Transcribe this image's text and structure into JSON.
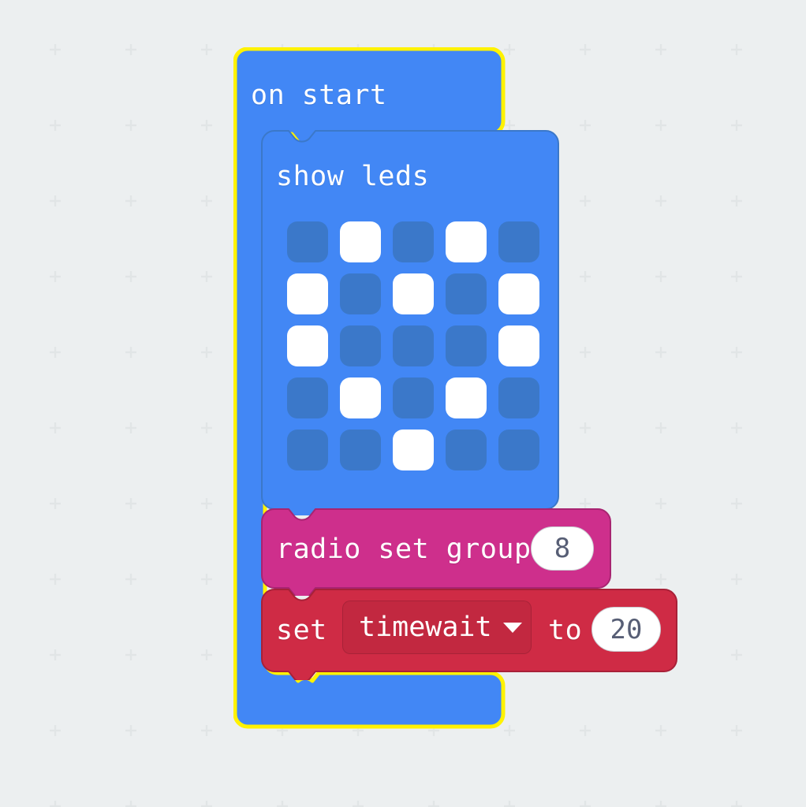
{
  "workspace": {
    "background_color": "#eceff0",
    "grid_cross_color": "#e2e5e6",
    "grid_spacing": 96
  },
  "palette": {
    "event_blue": "#4287f5",
    "event_blue_stroke": "#3b78c9",
    "led_off": "#3b78c9",
    "led_on": "#ffffff",
    "radio_pink": "#ce2f8c",
    "radio_pink_stroke": "#a82471",
    "variable_red": "#cf2b45",
    "variable_red_stroke": "#a82138",
    "selection_yellow": "#fff200",
    "field_text": "#575e75"
  },
  "blocks": {
    "on_start": {
      "label": "on start",
      "type": "event-hat",
      "selected": true
    },
    "show_leds": {
      "label": "show leds",
      "type": "statement",
      "grid": [
        [
          0,
          1,
          0,
          1,
          0
        ],
        [
          1,
          0,
          1,
          0,
          1
        ],
        [
          1,
          0,
          0,
          0,
          1
        ],
        [
          0,
          1,
          0,
          1,
          0
        ],
        [
          0,
          0,
          1,
          0,
          0
        ]
      ]
    },
    "radio_set_group": {
      "label": "radio set group",
      "type": "statement",
      "value": "8"
    },
    "set_variable": {
      "label_prefix": "set",
      "label_middle": "to",
      "variable_name": "timewait",
      "value": "20",
      "dropdown_icon": "chevron-down-icon",
      "type": "statement"
    }
  }
}
